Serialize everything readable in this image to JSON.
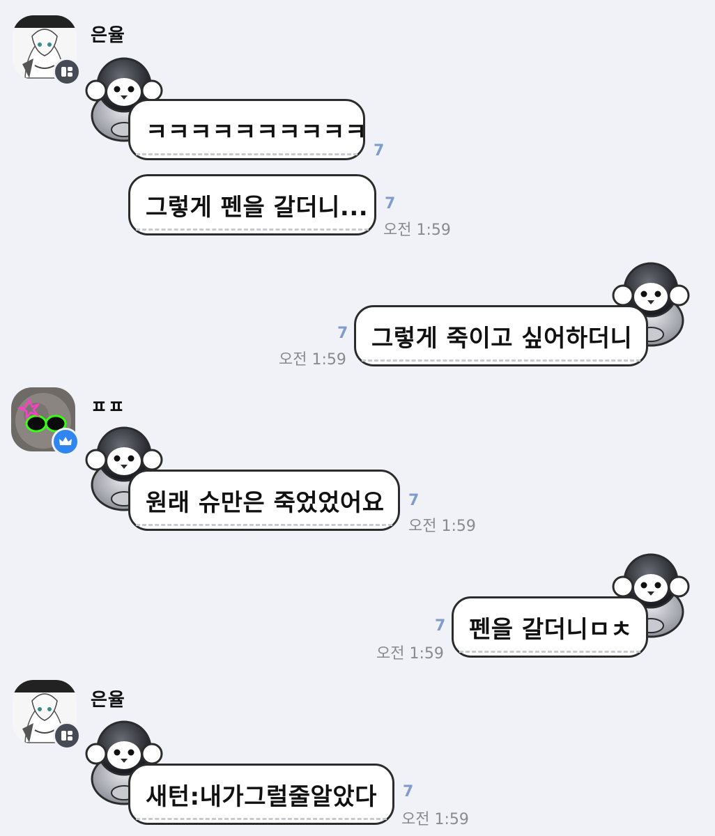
{
  "messages": [
    {
      "sender": "은율",
      "text": "ㅋㅋㅋㅋㅋㅋㅋㅋㅋㅋ",
      "unread": "7",
      "time": ""
    },
    {
      "sender": "은율",
      "text": "그렇게 펜을 갈더니...",
      "unread": "7",
      "time": "오전 1:59"
    },
    {
      "sender": "me",
      "text": "그렇게 죽이고 싶어하더니",
      "unread": "7",
      "time": "오전 1:59"
    },
    {
      "sender": "ㅍㅍ",
      "text": "원래 슈만은 죽었었어요",
      "unread": "7",
      "time": "오전 1:59"
    },
    {
      "sender": "me",
      "text": "펜을 갈더니ㅁㅊ",
      "unread": "7",
      "time": "오전 1:59"
    },
    {
      "sender": "은율",
      "text": "새턴:내가그럴줄알았다",
      "unread": "7",
      "time": "오전 1:59"
    }
  ],
  "users": [
    {
      "name": "은율",
      "avatar_icon": "sketch-portrait-avatar",
      "badge_icon": "open-chat-badge-icon"
    },
    {
      "name": "ㅍㅍ",
      "avatar_icon": "sunglasses-avatar",
      "badge_icon": "crown-icon"
    },
    {
      "name": "은율",
      "avatar_icon": "sketch-portrait-avatar",
      "badge_icon": "open-chat-badge-icon"
    }
  ],
  "colors": {
    "background": "#f1f2f7",
    "bubble": "#ffffff",
    "bubble_border": "#2b2b2b",
    "unread_count": "#7f9ccb",
    "timestamp": "#888a91",
    "host_badge": "#2f86f0",
    "member_badge": "#454a55"
  }
}
